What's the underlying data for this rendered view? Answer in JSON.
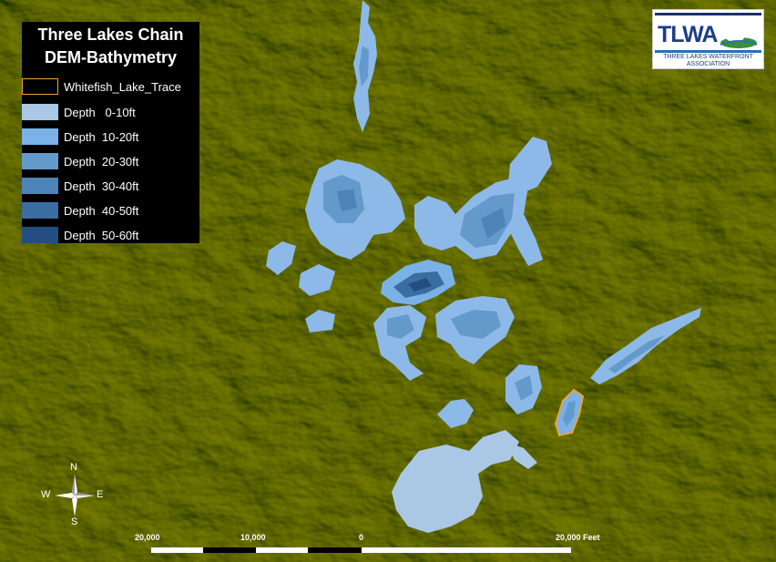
{
  "legend": {
    "title_line1": "Three Lakes Chain",
    "title_line2": "DEM-Bathymetry",
    "items": [
      {
        "label": "Whitefish_Lake_Trace",
        "color": "#000000",
        "border": "#e8a33a"
      },
      {
        "label": "Depth   0-10ft",
        "color": "#aac8e6"
      },
      {
        "label": "Depth  10-20ft",
        "color": "#7ab2e8"
      },
      {
        "label": "Depth  20-30ft",
        "color": "#639acb"
      },
      {
        "label": "Depth  30-40ft",
        "color": "#4c83b8"
      },
      {
        "label": "Depth  40-50ft",
        "color": "#3a6da1"
      },
      {
        "label": "Depth  50-60ft",
        "color": "#244e82"
      }
    ]
  },
  "logo": {
    "text": "TLWA",
    "subtitle": "THREE LAKES WATERFRONT ASSOCIATION"
  },
  "compass": {
    "n": "N",
    "s": "S",
    "e": "E",
    "w": "W"
  },
  "scalebar": {
    "labels": [
      "20,000",
      "10,000",
      "0",
      "20,000 Feet"
    ]
  },
  "colors": {
    "terrain_base": "#2c3d12",
    "terrain_light": "#6b7a22",
    "terrain_highlight": "#a69a3a",
    "shallow": "#aac8e6",
    "mid": "#7ab2e8",
    "deep": "#4c83b8",
    "deepest": "#244e82",
    "trace": "#e8a33a"
  }
}
